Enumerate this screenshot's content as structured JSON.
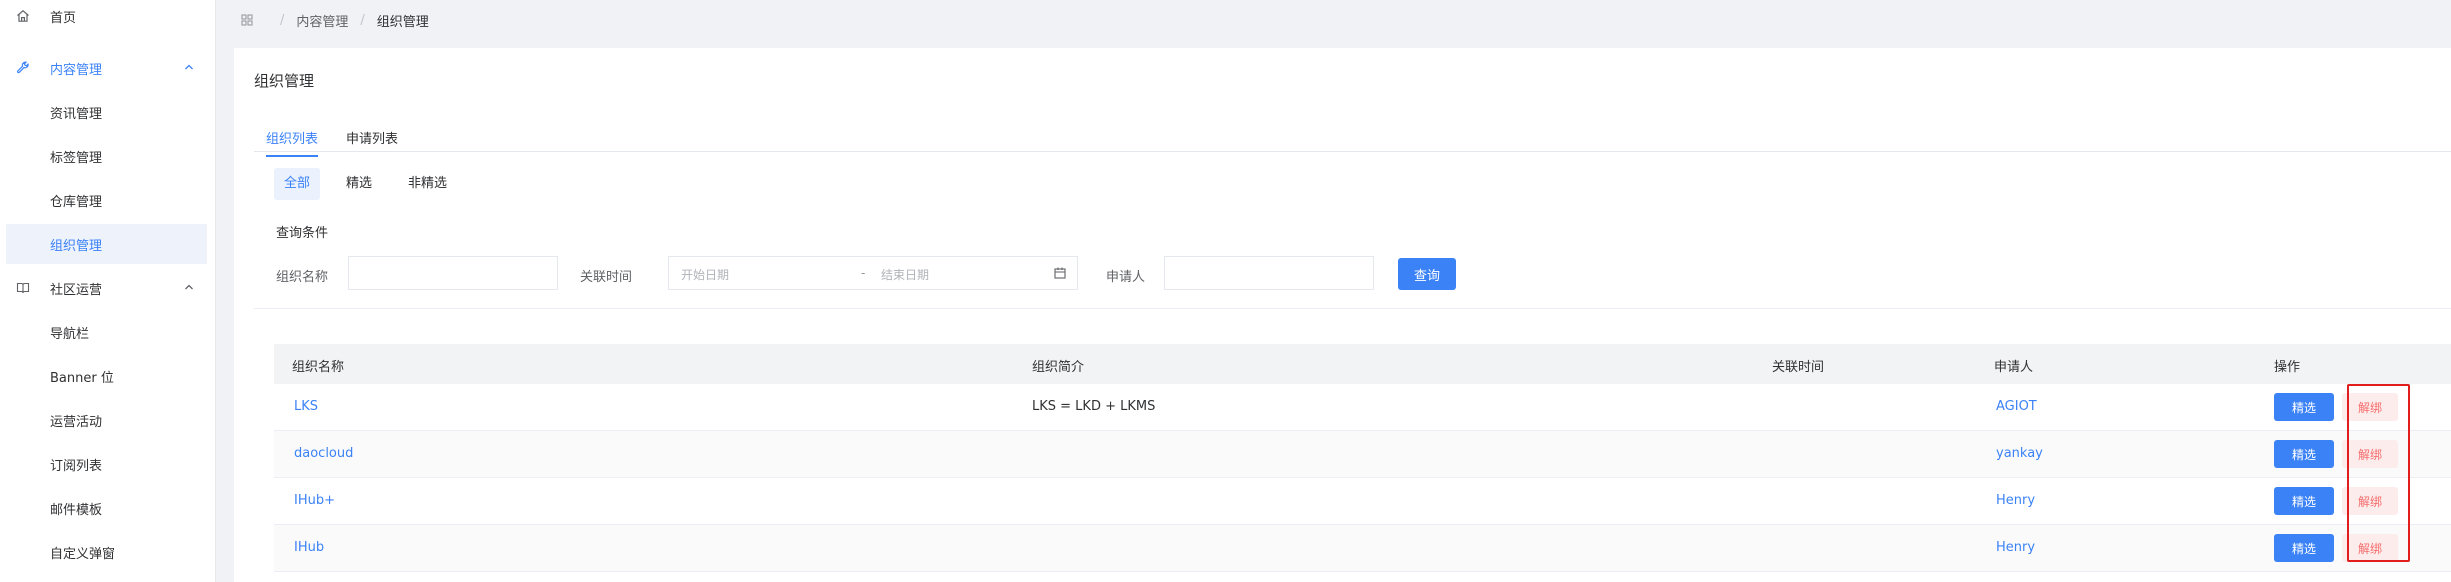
{
  "sidebar": {
    "home": {
      "label": "首页",
      "icon": "home-icon"
    },
    "content_mgmt": {
      "label": "内容管理",
      "icon": "wrench-icon",
      "items": [
        "资讯管理",
        "标签管理",
        "仓库管理",
        "组织管理"
      ]
    },
    "community_ops": {
      "label": "社区运营",
      "icon": "book-icon",
      "items": [
        "导航栏",
        "Banner 位",
        "运营活动",
        "订阅列表",
        "邮件模板",
        "自定义弹窗"
      ]
    }
  },
  "breadcrumb": {
    "icon": "grid-icon",
    "items": [
      "内容管理",
      "组织管理"
    ]
  },
  "page": {
    "title": "组织管理",
    "tabs": [
      "组织列表",
      "申请列表"
    ],
    "filters": [
      "全部",
      "精选",
      "非精选"
    ],
    "query": {
      "title": "查询条件",
      "org_name_label": "组织名称",
      "org_name_value": "",
      "time_label": "关联时间",
      "start_placeholder": "开始日期",
      "range_sep": "-",
      "end_placeholder": "结束日期",
      "applicant_label": "申请人",
      "applicant_value": "",
      "submit_label": "查询"
    }
  },
  "table": {
    "columns": [
      "组织名称",
      "组织简介",
      "关联时间",
      "申请人",
      "操作"
    ],
    "rows": [
      {
        "name": "LKS",
        "intro": "LKS = LKD + LKMS",
        "time": "",
        "applicant": "AGIOT"
      },
      {
        "name": "daocloud",
        "intro": "",
        "time": "",
        "applicant": "yankay"
      },
      {
        "name": "IHub+",
        "intro": "",
        "time": "",
        "applicant": "Henry"
      },
      {
        "name": "IHub",
        "intro": "",
        "time": "",
        "applicant": "Henry"
      }
    ],
    "action_select": "精选",
    "action_unbind": "解绑"
  },
  "colors": {
    "accent": "#3b82f6",
    "danger": "#f56c6c",
    "highlight": "#e11d1d"
  }
}
